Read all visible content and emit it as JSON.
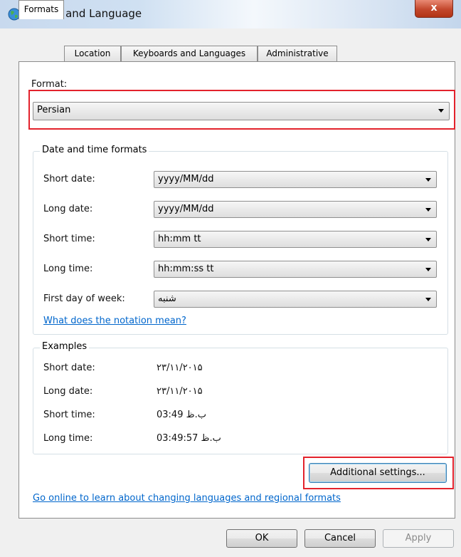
{
  "window": {
    "title": "Region and Language",
    "close_label": "x"
  },
  "tabs": [
    {
      "label": "Formats",
      "active": true
    },
    {
      "label": "Location",
      "active": false
    },
    {
      "label": "Keyboards and Languages",
      "active": false
    },
    {
      "label": "Administrative",
      "active": false
    }
  ],
  "format": {
    "label": "Format:",
    "value": "Persian"
  },
  "date_time": {
    "title": "Date and time formats",
    "rows": [
      {
        "label": "Short date:",
        "value": "yyyy/MM/dd"
      },
      {
        "label": "Long date:",
        "value": "yyyy/MM/dd"
      },
      {
        "label": "Short time:",
        "value": "hh:mm tt"
      },
      {
        "label": "Long time:",
        "value": "hh:mm:ss tt"
      },
      {
        "label": "First day of week:",
        "value": "شنبه"
      }
    ],
    "notation_link": "What does the notation mean?"
  },
  "examples": {
    "title": "Examples",
    "rows": [
      {
        "label": "Short date:",
        "value": "۲۳/۱۱/۲۰۱۵"
      },
      {
        "label": "Long date:",
        "value": "۲۳/۱۱/۲۰۱۵"
      },
      {
        "label": "Short time:",
        "value": "03:49 ب.ظ"
      },
      {
        "label": "Long time:",
        "value": "03:49:57 ب.ظ"
      }
    ]
  },
  "additional_settings_label": "Additional settings...",
  "online_link": "Go online to learn about changing languages and regional formats",
  "buttons": {
    "ok": "OK",
    "cancel": "Cancel",
    "apply": "Apply"
  },
  "colors": {
    "highlight": "#e3222c",
    "link": "#0066cc"
  }
}
